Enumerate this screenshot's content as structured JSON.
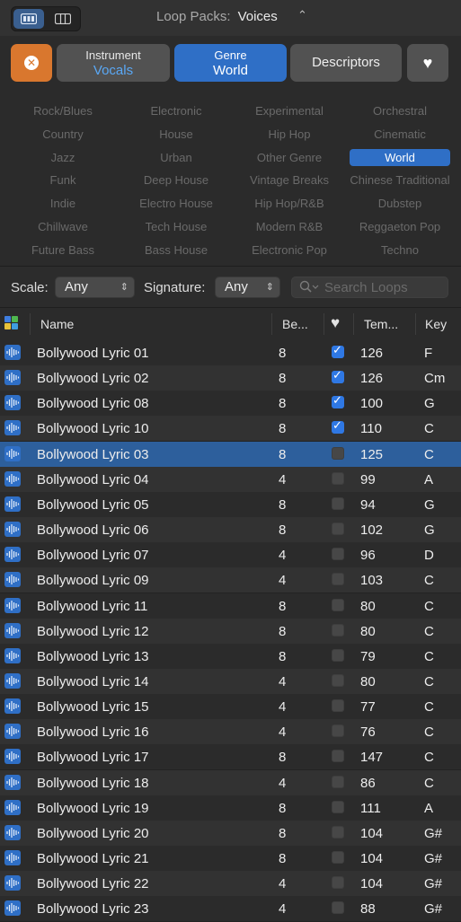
{
  "toolbar": {
    "loop_packs_label": "Loop Packs:",
    "loop_packs_value": "Voices"
  },
  "filters": {
    "instrument": {
      "title": "Instrument",
      "value": "Vocals"
    },
    "genre": {
      "title": "Genre",
      "value": "World"
    },
    "descriptors": {
      "title": "Descriptors"
    },
    "favorites_icon": "heart-icon",
    "reset_icon": "close-icon"
  },
  "genres": [
    "Rock/Blues",
    "Electronic",
    "Experimental",
    "Orchestral",
    "Country",
    "House",
    "Hip Hop",
    "Cinematic",
    "Jazz",
    "Urban",
    "Other Genre",
    "World",
    "Funk",
    "Deep House",
    "Vintage Breaks",
    "Chinese Traditional",
    "Indie",
    "Electro House",
    "Hip Hop/R&B",
    "Dubstep",
    "Chillwave",
    "Tech House",
    "Modern R&B",
    "Reggaeton Pop",
    "Future Bass",
    "Bass House",
    "Electronic Pop",
    "Techno"
  ],
  "selected_genre": "World",
  "search": {
    "scale_label": "Scale:",
    "scale_value": "Any",
    "signature_label": "Signature:",
    "signature_value": "Any",
    "placeholder": "Search Loops"
  },
  "table": {
    "headers": {
      "name": "Name",
      "beats": "Be...",
      "fav": "heart-icon",
      "tempo": "Tem...",
      "key": "Key"
    },
    "rows": [
      {
        "name": "Bollywood Lyric 01",
        "beats": "8",
        "fav": true,
        "tempo": "126",
        "key": "F"
      },
      {
        "name": "Bollywood Lyric 02",
        "beats": "8",
        "fav": true,
        "tempo": "126",
        "key": "Cm"
      },
      {
        "name": "Bollywood Lyric 08",
        "beats": "8",
        "fav": true,
        "tempo": "100",
        "key": "G"
      },
      {
        "name": "Bollywood Lyric 10",
        "beats": "8",
        "fav": true,
        "tempo": "110",
        "key": "C"
      },
      {
        "name": "Bollywood Lyric 03",
        "beats": "8",
        "fav": false,
        "tempo": "125",
        "key": "C",
        "selected": true
      },
      {
        "name": "Bollywood Lyric 04",
        "beats": "4",
        "fav": false,
        "tempo": "99",
        "key": "A"
      },
      {
        "name": "Bollywood Lyric 05",
        "beats": "8",
        "fav": false,
        "tempo": "94",
        "key": "G"
      },
      {
        "name": "Bollywood Lyric 06",
        "beats": "8",
        "fav": false,
        "tempo": "102",
        "key": "G"
      },
      {
        "name": "Bollywood Lyric 07",
        "beats": "4",
        "fav": false,
        "tempo": "96",
        "key": "D"
      },
      {
        "name": "Bollywood Lyric 09",
        "beats": "4",
        "fav": false,
        "tempo": "103",
        "key": "C"
      },
      {
        "name": "Bollywood Lyric 11",
        "beats": "8",
        "fav": false,
        "tempo": "80",
        "key": "C"
      },
      {
        "name": "Bollywood Lyric 12",
        "beats": "8",
        "fav": false,
        "tempo": "80",
        "key": "C"
      },
      {
        "name": "Bollywood Lyric 13",
        "beats": "8",
        "fav": false,
        "tempo": "79",
        "key": "C"
      },
      {
        "name": "Bollywood Lyric 14",
        "beats": "4",
        "fav": false,
        "tempo": "80",
        "key": "C"
      },
      {
        "name": "Bollywood Lyric 15",
        "beats": "4",
        "fav": false,
        "tempo": "77",
        "key": "C"
      },
      {
        "name": "Bollywood Lyric 16",
        "beats": "4",
        "fav": false,
        "tempo": "76",
        "key": "C"
      },
      {
        "name": "Bollywood Lyric 17",
        "beats": "8",
        "fav": false,
        "tempo": "147",
        "key": "C"
      },
      {
        "name": "Bollywood Lyric 18",
        "beats": "4",
        "fav": false,
        "tempo": "86",
        "key": "C"
      },
      {
        "name": "Bollywood Lyric 19",
        "beats": "8",
        "fav": false,
        "tempo": "111",
        "key": "A"
      },
      {
        "name": "Bollywood Lyric 20",
        "beats": "8",
        "fav": false,
        "tempo": "104",
        "key": "G#"
      },
      {
        "name": "Bollywood Lyric 21",
        "beats": "8",
        "fav": false,
        "tempo": "104",
        "key": "G#"
      },
      {
        "name": "Bollywood Lyric 22",
        "beats": "4",
        "fav": false,
        "tempo": "104",
        "key": "G#"
      },
      {
        "name": "Bollywood Lyric 23",
        "beats": "4",
        "fav": false,
        "tempo": "88",
        "key": "G#"
      }
    ]
  },
  "colors": {
    "accent": "#2f6fc6",
    "reset": "#d9772e",
    "selected_row": "#2d5f9c",
    "instrument_value": "#5aa8f5"
  }
}
